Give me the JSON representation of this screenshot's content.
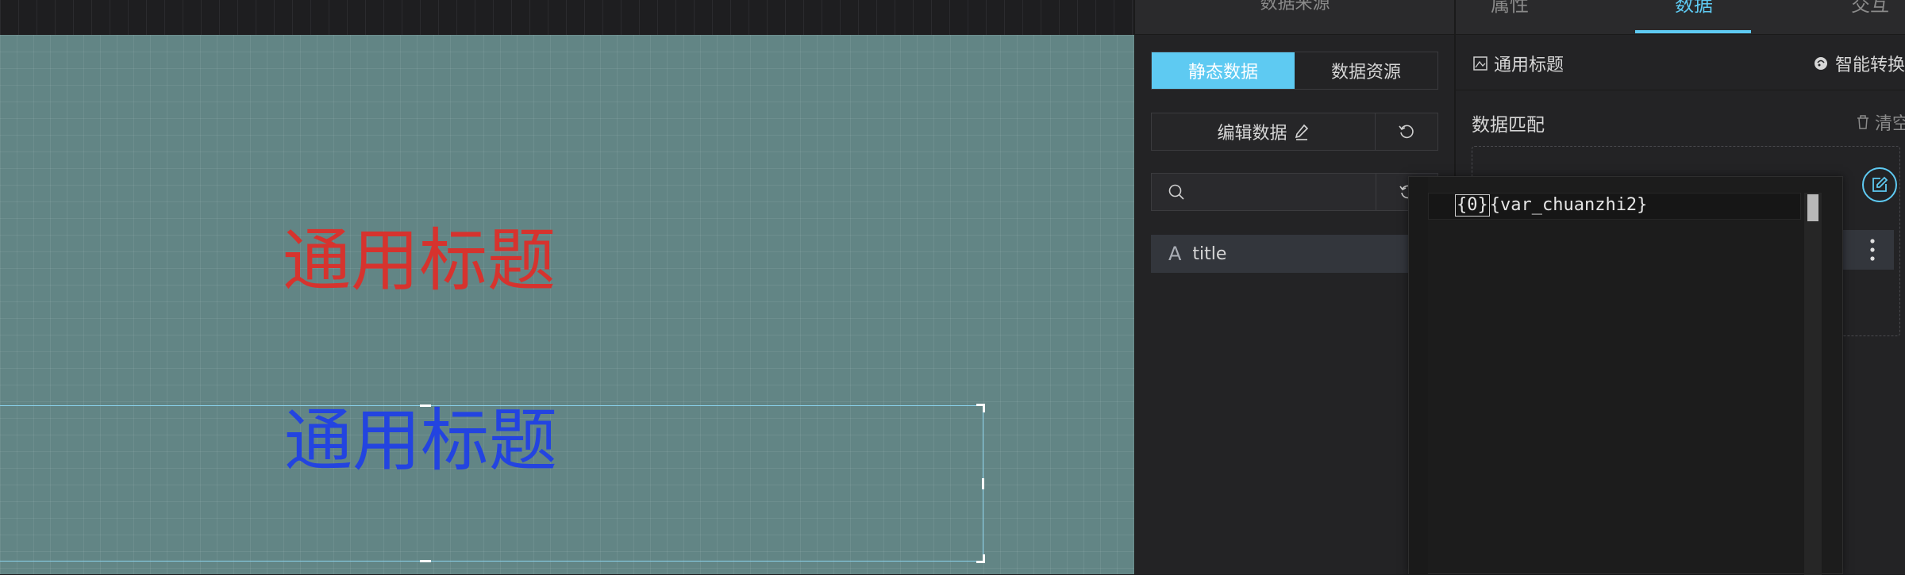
{
  "canvas": {
    "title_red": "通用标题",
    "title_blue": "通用标题"
  },
  "data_source": {
    "header": "数据来源",
    "tabs": [
      "静态数据",
      "数据资源"
    ],
    "active_tab": "静态数据",
    "edit_label": "编辑数据",
    "search": {
      "value": "",
      "placeholder": ""
    },
    "fields": [
      {
        "type_icon": "A",
        "name": "title"
      }
    ]
  },
  "property_panel": {
    "tabs": [
      "属性",
      "数据",
      "交互"
    ],
    "active_tab": "数据",
    "component_name": "通用标题",
    "smart_convert": "智能转换",
    "match_label": "数据匹配",
    "clear_label": "清空"
  },
  "editor": {
    "code_token_1": "{0}",
    "code_rest": "{var_chuanzhi2}"
  },
  "colors": {
    "accent": "#5ecaf2",
    "title_red": "#d6332e",
    "title_blue": "#2344e0",
    "canvas_bg": "#628585"
  }
}
